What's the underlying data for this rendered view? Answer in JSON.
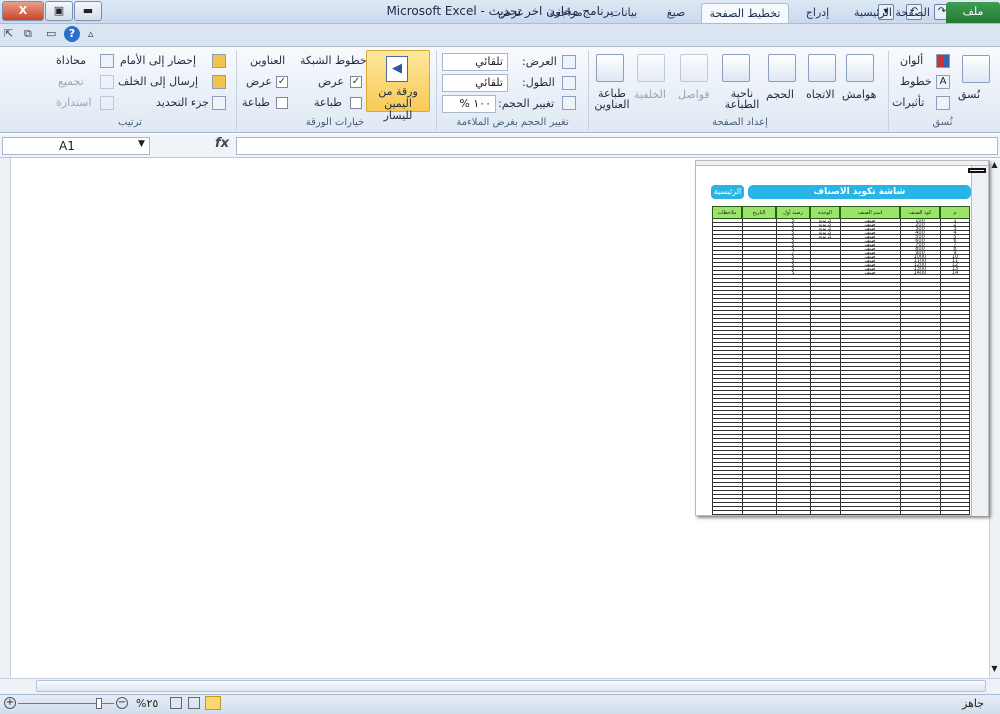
{
  "window": {
    "title": "برنامج مخازن اخر تحديث - Microsoft Excel",
    "close_label": "X",
    "file_icon_label": "X"
  },
  "tabs": [
    {
      "label": "ملف"
    },
    {
      "label": "الصفحة الرئيسية"
    },
    {
      "label": "إدراج"
    },
    {
      "label": "تخطيط الصفحة"
    },
    {
      "label": "صيغ"
    },
    {
      "label": "بيانات"
    },
    {
      "label": "مراجعة"
    },
    {
      "label": "عرض"
    }
  ],
  "ribbon": {
    "themes": {
      "colors": "ألوان",
      "fonts": "خطوط",
      "effects": "تأثيرات",
      "themes": "نُسق",
      "group": "نُسق"
    },
    "page_setup": {
      "margins": "هوامش",
      "orientation": "الاتجاه",
      "size": "الحجم",
      "print_area": "ناحية الطباعة",
      "breaks": "فواصل",
      "background": "الخلفية",
      "print_titles": "طباعة العناوين",
      "group": "إعداد الصفحة"
    },
    "scale": {
      "width_label": "العرض:",
      "width_value": "تلقائي",
      "height_label": "الطول:",
      "height_value": "تلقائي",
      "scale_label": "تغيير الحجم:",
      "scale_value": "١٠٠ %",
      "group": "تغيير الحجم بغرض الملاءمة"
    },
    "sheet_options": {
      "rtl_button": "ورقة من اليمين لليسار",
      "gridlines": "خطوط الشبكة",
      "headings": "العناوين",
      "view": "عرض",
      "print": "طباعة",
      "view2": "عرض",
      "print2": "طباعة",
      "group": "خيارات الورقة"
    },
    "arrange": {
      "bring_forward": "إحضار إلى الأمام",
      "send_backward": "إرسال إلى الخلف",
      "selection_pane": "جزء التحديد",
      "align": "محاذاة",
      "group_btn": "تجميع",
      "rotate": "استدارة",
      "group": "ترتيب"
    }
  },
  "formula_bar": {
    "name_box": "A1",
    "fx": "fx",
    "formula": ""
  },
  "sheet": {
    "title": "شاشة تكويد الاصناف",
    "home_button": "الرئيسية",
    "headers": [
      "م",
      "كود الصنف",
      "اسم الصنف",
      "الوحدة",
      "رصيد أول",
      "التاريخ",
      "ملاحظات"
    ],
    "rows": [
      {
        "n": "1",
        "code": "100",
        "name": "صنف",
        "unit": "كرتونة",
        "qty": "5"
      },
      {
        "n": "2",
        "code": "200",
        "name": "صنف",
        "unit": "كرتونة",
        "qty": "5"
      },
      {
        "n": "3",
        "code": "300",
        "name": "صنف",
        "unit": "كرتونة",
        "qty": "5"
      },
      {
        "n": "4",
        "code": "400",
        "name": "صنف",
        "unit": "كرتونة",
        "qty": "5"
      },
      {
        "n": "5",
        "code": "500",
        "name": "صنف",
        "unit": "كرتونة",
        "qty": "5"
      },
      {
        "n": "6",
        "code": "600",
        "name": "صنف",
        "unit": "",
        "qty": "5"
      },
      {
        "n": "7",
        "code": "700",
        "name": "صنف",
        "unit": "",
        "qty": "5"
      },
      {
        "n": "8",
        "code": "800",
        "name": "صنف",
        "unit": "",
        "qty": "5"
      },
      {
        "n": "9",
        "code": "900",
        "name": "صنف",
        "unit": "",
        "qty": "7"
      },
      {
        "n": "10",
        "code": "1000",
        "name": "صنف",
        "unit": "",
        "qty": "5"
      },
      {
        "n": "11",
        "code": "1100",
        "name": "صنف",
        "unit": "",
        "qty": "5"
      },
      {
        "n": "12",
        "code": "1200",
        "name": "صنف",
        "unit": "",
        "qty": "5"
      },
      {
        "n": "13",
        "code": "1300",
        "name": "صنف",
        "unit": "",
        "qty": "5"
      },
      {
        "n": "14",
        "code": "1400",
        "name": "صنف",
        "unit": "",
        "qty": "5"
      }
    ]
  },
  "status": {
    "ready": "جاهز",
    "zoom": "%٢٥"
  }
}
